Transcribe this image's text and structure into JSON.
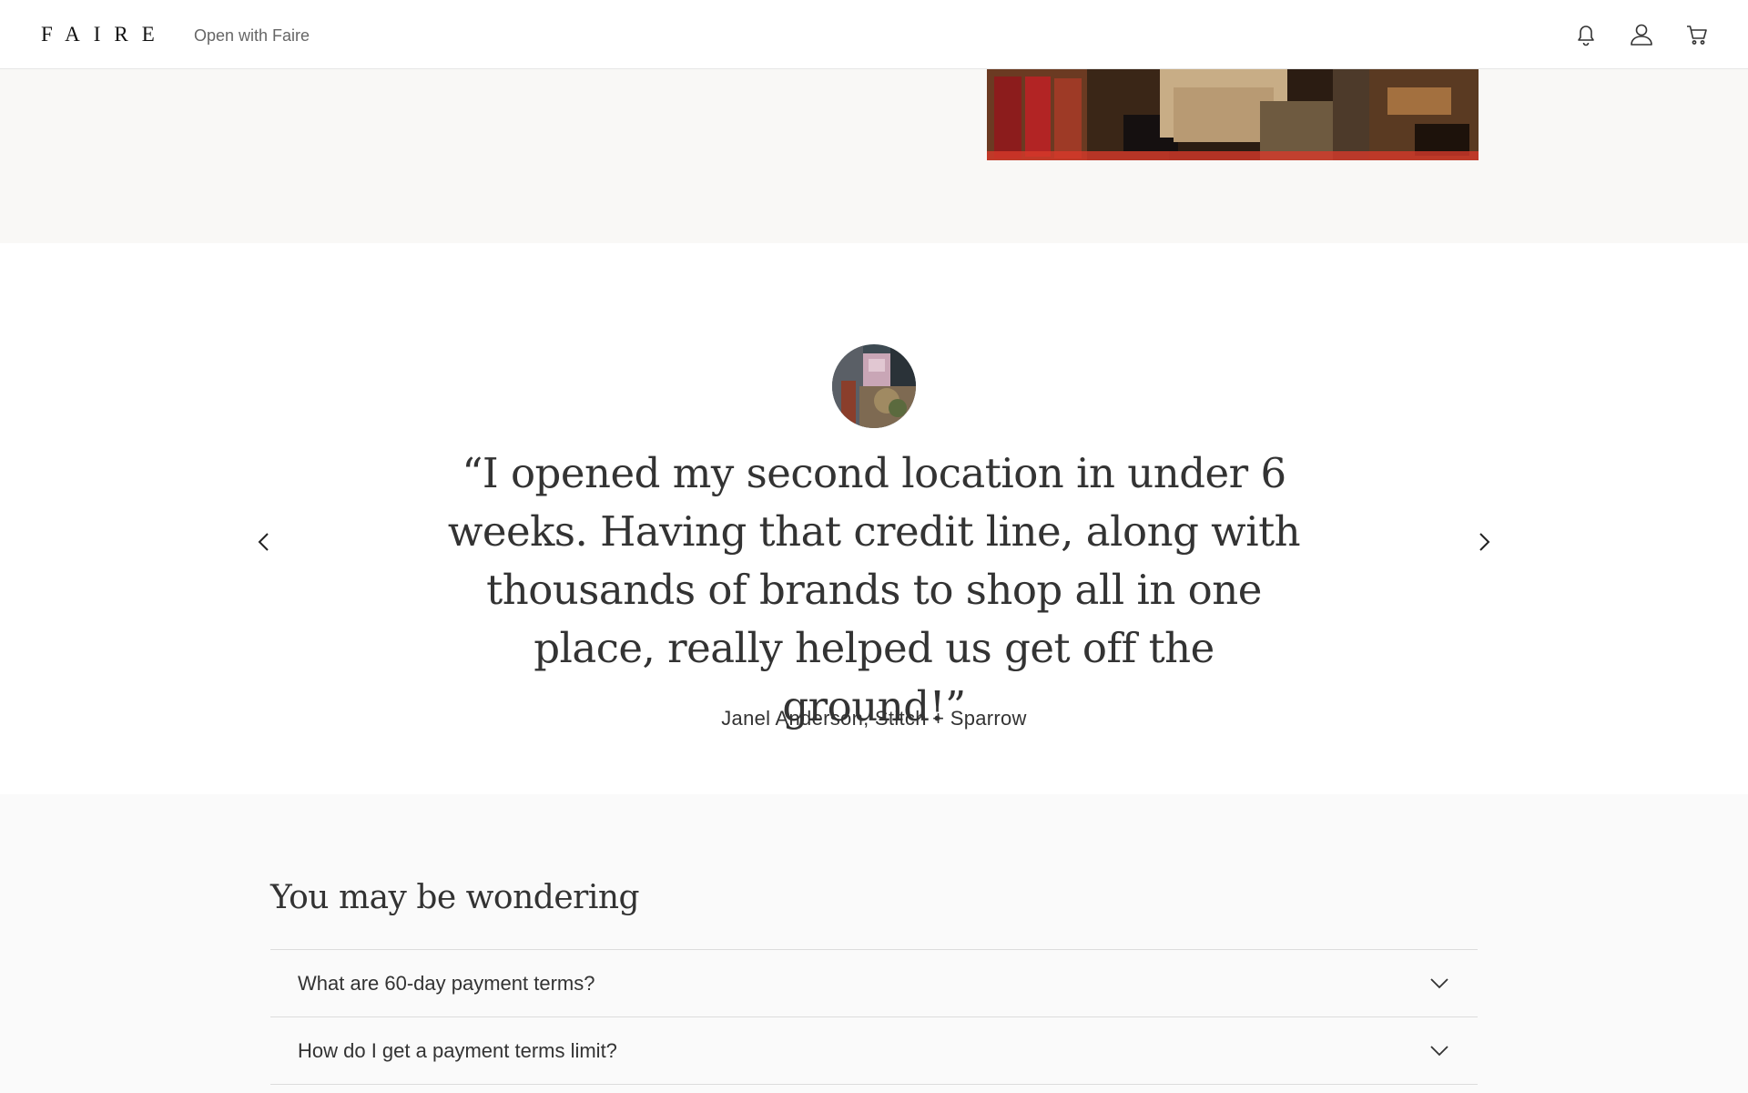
{
  "header": {
    "logo": "FAIRE",
    "open_link": "Open with Faire",
    "icons": [
      "bell-icon",
      "account-icon",
      "cart-icon"
    ]
  },
  "testimonial": {
    "quote": "“I opened my second location in under 6 weeks. Having that credit line, along with thousands of brands to shop all in one place, really helped us get off the ground!”",
    "attribution": "Janel Anderson, Stitch + Sparrow",
    "prev_icon": "chevron-left-icon",
    "next_icon": "chevron-right-icon"
  },
  "faq": {
    "title": "You may be wondering",
    "items": [
      {
        "question": "What are 60-day payment terms?"
      },
      {
        "question": "How do I get a payment terms limit?"
      }
    ]
  },
  "colors": {
    "text": "#333333",
    "band_beige": "#f9f8f6",
    "faq_bg": "#fafafa",
    "divider": "#dcdcdc"
  }
}
